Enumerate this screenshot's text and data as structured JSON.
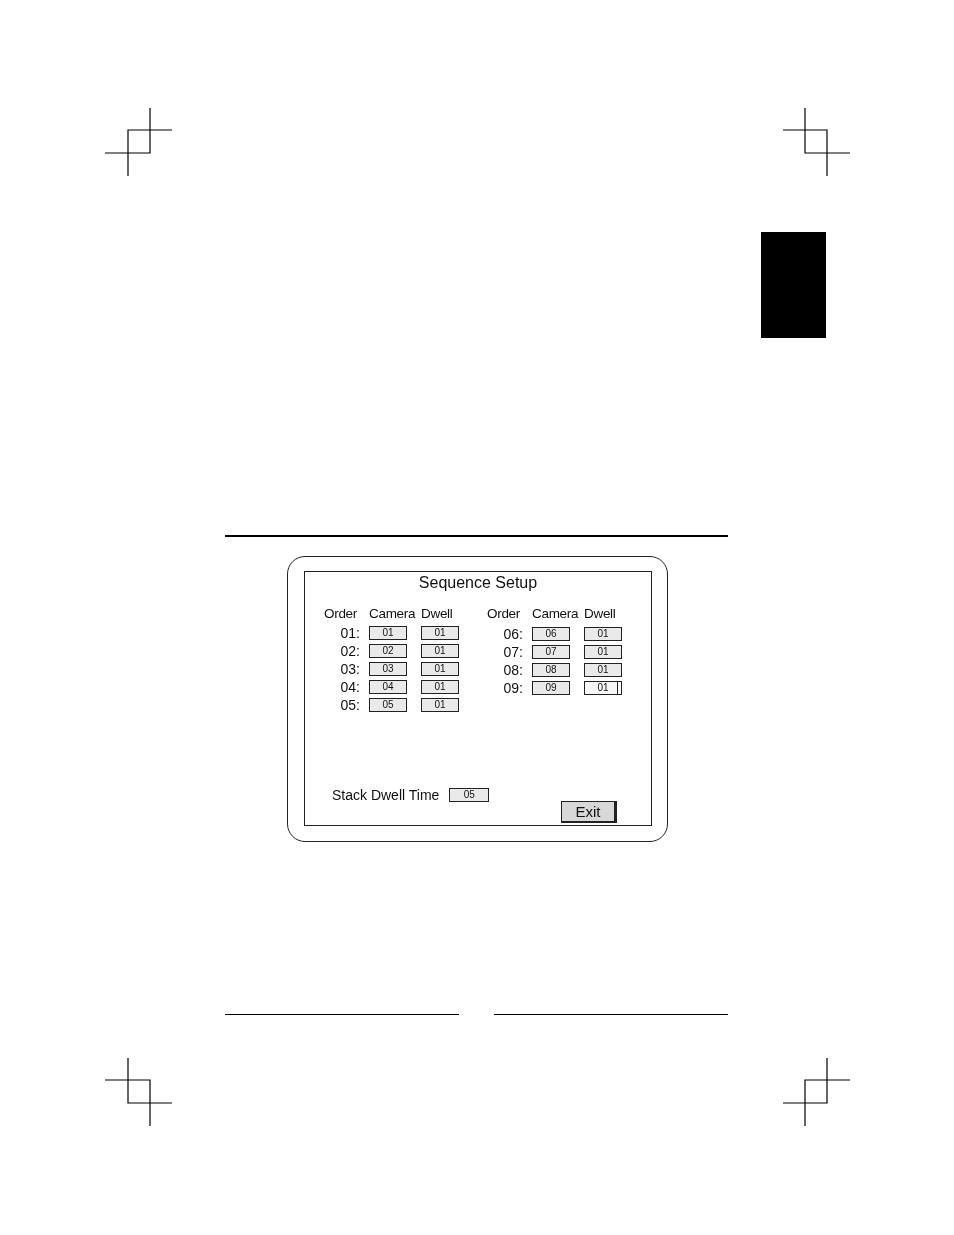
{
  "screen": {
    "title": "Sequence Setup",
    "groups": [
      {
        "headers": [
          "Order",
          "Camera",
          "Dwell"
        ],
        "rows": [
          {
            "order": "01:",
            "camera": "01",
            "dwell": "01",
            "dwell_selected": false
          },
          {
            "order": "02:",
            "camera": "02",
            "dwell": "01",
            "dwell_selected": false
          },
          {
            "order": "03:",
            "camera": "03",
            "dwell": "01",
            "dwell_selected": false
          },
          {
            "order": "04:",
            "camera": "04",
            "dwell": "01",
            "dwell_selected": false
          },
          {
            "order": "05:",
            "camera": "05",
            "dwell": "01",
            "dwell_selected": false
          }
        ]
      },
      {
        "headers": [
          "Order",
          "Camera",
          "Dwell"
        ],
        "rows": [
          {
            "order": "06:",
            "camera": "06",
            "dwell": "01",
            "dwell_selected": false
          },
          {
            "order": "07:",
            "camera": "07",
            "dwell": "01",
            "dwell_selected": false
          },
          {
            "order": "08:",
            "camera": "08",
            "dwell": "01",
            "dwell_selected": false
          },
          {
            "order": "09:",
            "camera": "09",
            "dwell": "01",
            "dwell_selected": true
          }
        ]
      }
    ],
    "stack_dwell": {
      "label": "Stack Dwell Time",
      "value": "05"
    },
    "exit_button": "Exit"
  }
}
